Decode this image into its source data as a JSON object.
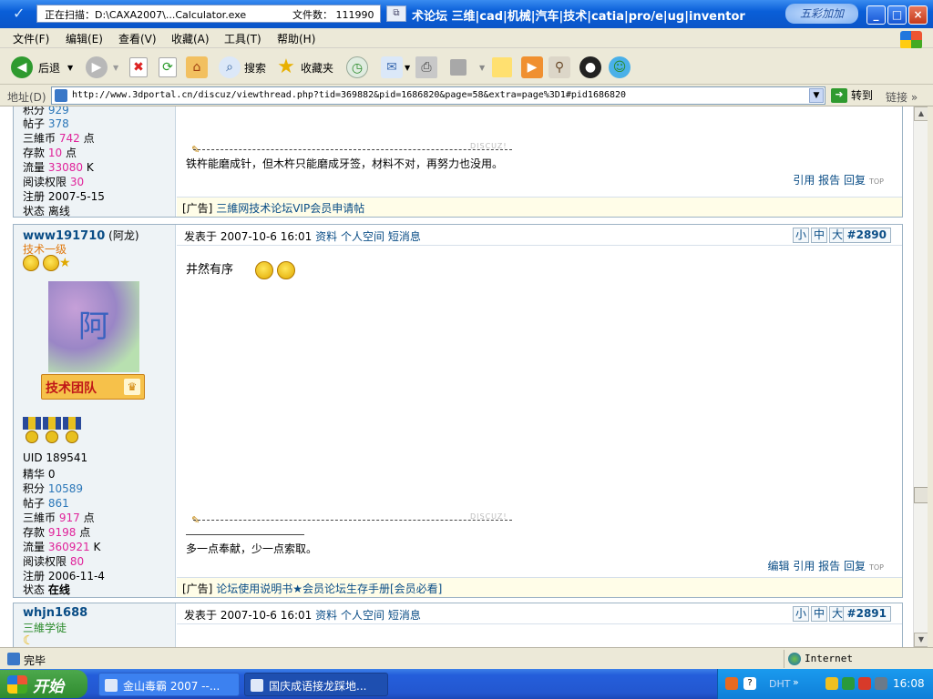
{
  "window": {
    "scan_status": "正在扫描：D:\\CAXA2007\\...Calculator.exe",
    "scan_count": "文件数： 111990",
    "title": "术论坛 三维|cad|机械|汽车|技术|catia|pro/e|ug|inventor",
    "title_logo": "五彩加加",
    "min_label": "_",
    "max_label": "□",
    "close_label": "×"
  },
  "menu": [
    "文件(F)",
    "编辑(E)",
    "查看(V)",
    "收藏(A)",
    "工具(T)",
    "帮助(H)"
  ],
  "toolbar": {
    "back": "后退",
    "search": "搜索",
    "favorites": "收藏夹"
  },
  "address": {
    "label": "地址(D)",
    "url": "http://www.3dportal.cn/discuz/viewthread.php?tid=369882&pid=1686820&page=58&extra=page%3D1#pid1686820",
    "go": "转到",
    "links": "链接"
  },
  "post1": {
    "stats": [
      {
        "label": "积分",
        "value": "929",
        "unit": ""
      },
      {
        "label": "帖子",
        "value": "378",
        "unit": ""
      },
      {
        "label": "三維币",
        "value": "742",
        "unit": "点"
      },
      {
        "label": "存款",
        "value": "10",
        "unit": "点"
      },
      {
        "label": "流量",
        "value": "33080",
        "unit": "K"
      },
      {
        "label": "阅读权限",
        "value": "30",
        "unit": ""
      }
    ],
    "reg": "注册 2007-5-15",
    "status": "状态 离线",
    "signature": "铁杵能磨成针，但木杵只能磨成牙签，材料不对，再努力也没用。",
    "discuz": "DISCUZ!",
    "actions": "引用 报告 回复",
    "ad_prefix": "[广告]",
    "ad": "三維网技术论坛VIP会员申请帖"
  },
  "post2": {
    "username": "www191710",
    "nickname": "(阿龙)",
    "rank": "技术一级",
    "avatar_char": "阿",
    "team_badge": "技术团队",
    "uid": "UID 189541",
    "stats": [
      {
        "label": "精华",
        "value": "0",
        "unit": ""
      },
      {
        "label": "积分",
        "value": "10589",
        "unit": ""
      },
      {
        "label": "帖子",
        "value": "861",
        "unit": ""
      },
      {
        "label": "三維币",
        "value": "917",
        "unit": "点"
      },
      {
        "label": "存款",
        "value": "9198",
        "unit": "点"
      },
      {
        "label": "流量",
        "value": "360921",
        "unit": "K"
      },
      {
        "label": "阅读权限",
        "value": "80",
        "unit": ""
      }
    ],
    "reg": "注册 2006-11-4",
    "status_label": "状态",
    "status_value": "在线",
    "posted": "发表于 2007-10-6 16:01",
    "links": [
      "资料",
      "个人空间",
      "短消息"
    ],
    "sizes": [
      "小",
      "中",
      "大"
    ],
    "floor": "#2890",
    "content": "井然有序",
    "signature": "多一点奉献，少一点索取。",
    "discuz": "DISCUZ!",
    "actions": "编辑 引用 报告 回复",
    "ad_prefix": "[广告]",
    "ad": "论坛使用说明书★会员论坛生存手册[会员必看]"
  },
  "post3": {
    "username": "whjn1688",
    "rank": "三維学徒",
    "posted": "发表于 2007-10-6 16:01",
    "links": [
      "资料",
      "个人空间",
      "短消息"
    ],
    "sizes": [
      "小",
      "中",
      "大"
    ],
    "floor": "#2891"
  },
  "status": {
    "text": "完毕",
    "zone": "Internet"
  },
  "taskbar": {
    "start": "开始",
    "tasks": [
      "金山毒霸 2007 --...",
      "国庆成语接龙踩地..."
    ],
    "dht": "DHT",
    "clock": "16:08"
  }
}
